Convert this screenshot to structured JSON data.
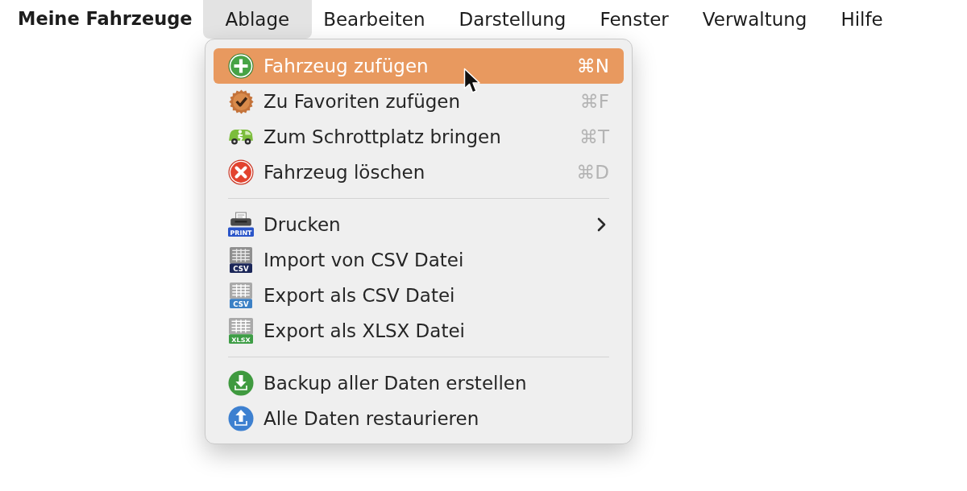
{
  "menu_bar": {
    "app_name": "Meine Fahrzeuge",
    "menus": [
      {
        "label": "Ablage",
        "selected": true
      },
      {
        "label": "Bearbeiten",
        "selected": false
      },
      {
        "label": "Darstellung",
        "selected": false
      },
      {
        "label": "Fenster",
        "selected": false
      },
      {
        "label": "Verwaltung",
        "selected": false
      },
      {
        "label": "Hilfe",
        "selected": false
      }
    ]
  },
  "dropdown": {
    "groups": [
      {
        "items": [
          {
            "label": "Fahrzeug zufügen",
            "shortcut": "⌘N",
            "selected": true
          },
          {
            "label": "Zu Favoriten zufügen",
            "shortcut": "⌘F",
            "selected": false
          },
          {
            "label": "Zum Schrottplatz bringen",
            "shortcut": "⌘T",
            "selected": false
          },
          {
            "label": "Fahrzeug löschen",
            "shortcut": "⌘D",
            "selected": false
          }
        ]
      },
      {
        "items": [
          {
            "label": "Drucken",
            "icon_text": "PRINT",
            "submenu": true,
            "selected": false
          },
          {
            "label": "Import von CSV Datei",
            "icon_text": "CSV",
            "selected": false
          },
          {
            "label": "Export als CSV Datei",
            "icon_text": "CSV",
            "selected": false
          },
          {
            "label": "Export als XLSX Datei",
            "icon_text": "XLSX",
            "selected": false
          }
        ]
      },
      {
        "items": [
          {
            "label": "Backup aller Daten erstellen",
            "selected": false
          },
          {
            "label": "Alle Daten restaurieren",
            "selected": false
          }
        ]
      }
    ]
  }
}
